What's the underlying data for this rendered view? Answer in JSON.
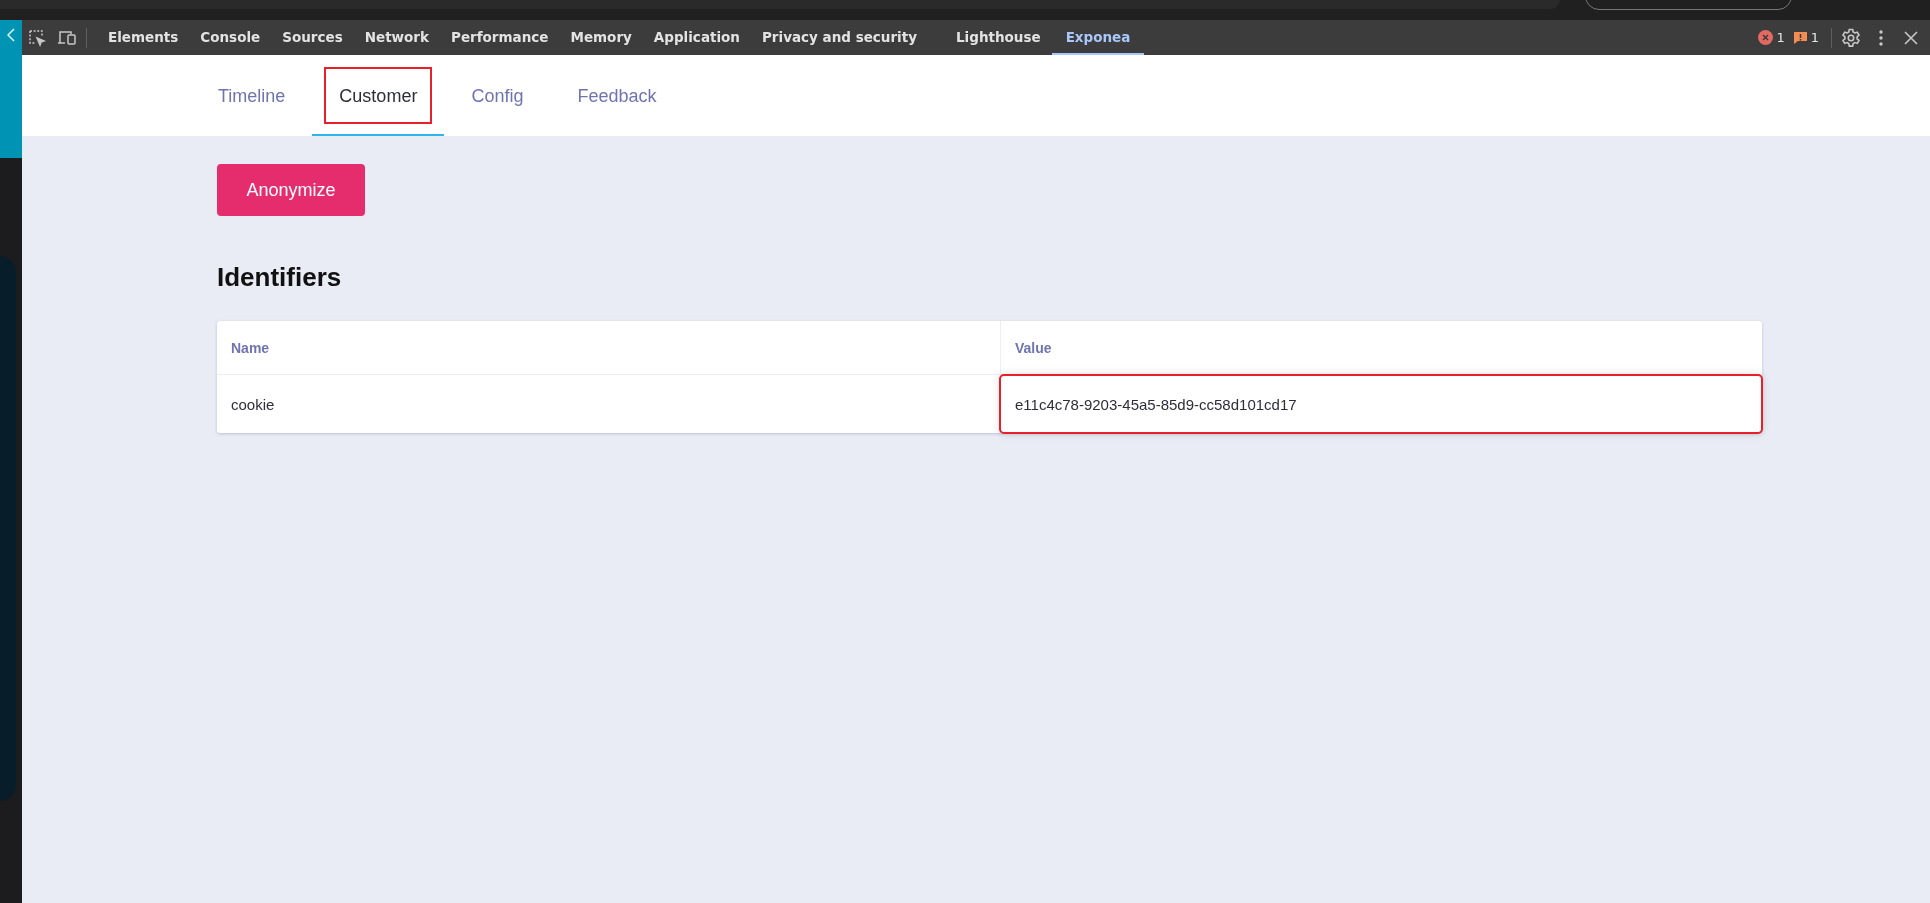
{
  "devtools": {
    "tabs": [
      {
        "label": "Elements",
        "selected": false
      },
      {
        "label": "Console",
        "selected": false
      },
      {
        "label": "Sources",
        "selected": false
      },
      {
        "label": "Network",
        "selected": false
      },
      {
        "label": "Performance",
        "selected": false
      },
      {
        "label": "Memory",
        "selected": false
      },
      {
        "label": "Application",
        "selected": false
      },
      {
        "label": "Privacy and security",
        "selected": false
      },
      {
        "label": "Lighthouse",
        "selected": false
      },
      {
        "label": "Exponea",
        "selected": true
      }
    ],
    "error_count": "1",
    "warning_count": "1"
  },
  "panel": {
    "tabs": [
      {
        "label": "Timeline",
        "selected": false,
        "highlighted": false
      },
      {
        "label": "Customer",
        "selected": true,
        "highlighted": true
      },
      {
        "label": "Config",
        "selected": false,
        "highlighted": false
      },
      {
        "label": "Feedback",
        "selected": false,
        "highlighted": false
      }
    ],
    "anonymize_button": "Anonymize",
    "section_title": "Identifiers",
    "table": {
      "columns": [
        "Name",
        "Value"
      ],
      "rows": [
        {
          "cells": [
            {
              "text": "cookie",
              "highlighted": false
            },
            {
              "text": "e11c4c78-9203-45a5-85d9-cc58d101cd17",
              "highlighted": true
            }
          ]
        }
      ]
    }
  }
}
